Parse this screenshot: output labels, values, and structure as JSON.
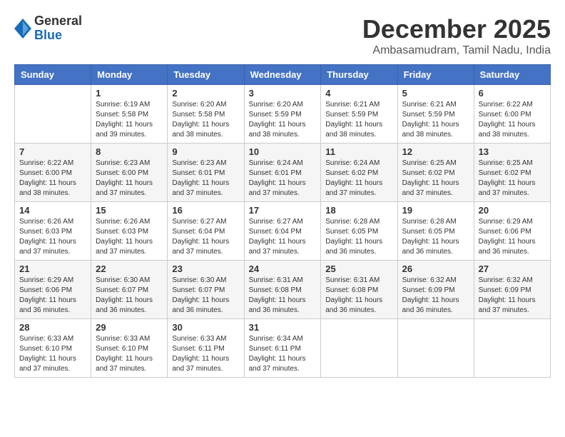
{
  "header": {
    "logo": {
      "general": "General",
      "blue": "Blue"
    },
    "title": "December 2025",
    "location": "Ambasamudram, Tamil Nadu, India"
  },
  "calendar": {
    "days_of_week": [
      "Sunday",
      "Monday",
      "Tuesday",
      "Wednesday",
      "Thursday",
      "Friday",
      "Saturday"
    ],
    "weeks": [
      [
        {
          "day": "",
          "info": ""
        },
        {
          "day": "1",
          "info": "Sunrise: 6:19 AM\nSunset: 5:58 PM\nDaylight: 11 hours\nand 39 minutes."
        },
        {
          "day": "2",
          "info": "Sunrise: 6:20 AM\nSunset: 5:58 PM\nDaylight: 11 hours\nand 38 minutes."
        },
        {
          "day": "3",
          "info": "Sunrise: 6:20 AM\nSunset: 5:59 PM\nDaylight: 11 hours\nand 38 minutes."
        },
        {
          "day": "4",
          "info": "Sunrise: 6:21 AM\nSunset: 5:59 PM\nDaylight: 11 hours\nand 38 minutes."
        },
        {
          "day": "5",
          "info": "Sunrise: 6:21 AM\nSunset: 5:59 PM\nDaylight: 11 hours\nand 38 minutes."
        },
        {
          "day": "6",
          "info": "Sunrise: 6:22 AM\nSunset: 6:00 PM\nDaylight: 11 hours\nand 38 minutes."
        }
      ],
      [
        {
          "day": "7",
          "info": "Sunrise: 6:22 AM\nSunset: 6:00 PM\nDaylight: 11 hours\nand 38 minutes."
        },
        {
          "day": "8",
          "info": "Sunrise: 6:23 AM\nSunset: 6:00 PM\nDaylight: 11 hours\nand 37 minutes."
        },
        {
          "day": "9",
          "info": "Sunrise: 6:23 AM\nSunset: 6:01 PM\nDaylight: 11 hours\nand 37 minutes."
        },
        {
          "day": "10",
          "info": "Sunrise: 6:24 AM\nSunset: 6:01 PM\nDaylight: 11 hours\nand 37 minutes."
        },
        {
          "day": "11",
          "info": "Sunrise: 6:24 AM\nSunset: 6:02 PM\nDaylight: 11 hours\nand 37 minutes."
        },
        {
          "day": "12",
          "info": "Sunrise: 6:25 AM\nSunset: 6:02 PM\nDaylight: 11 hours\nand 37 minutes."
        },
        {
          "day": "13",
          "info": "Sunrise: 6:25 AM\nSunset: 6:02 PM\nDaylight: 11 hours\nand 37 minutes."
        }
      ],
      [
        {
          "day": "14",
          "info": "Sunrise: 6:26 AM\nSunset: 6:03 PM\nDaylight: 11 hours\nand 37 minutes."
        },
        {
          "day": "15",
          "info": "Sunrise: 6:26 AM\nSunset: 6:03 PM\nDaylight: 11 hours\nand 37 minutes."
        },
        {
          "day": "16",
          "info": "Sunrise: 6:27 AM\nSunset: 6:04 PM\nDaylight: 11 hours\nand 37 minutes."
        },
        {
          "day": "17",
          "info": "Sunrise: 6:27 AM\nSunset: 6:04 PM\nDaylight: 11 hours\nand 37 minutes."
        },
        {
          "day": "18",
          "info": "Sunrise: 6:28 AM\nSunset: 6:05 PM\nDaylight: 11 hours\nand 36 minutes."
        },
        {
          "day": "19",
          "info": "Sunrise: 6:28 AM\nSunset: 6:05 PM\nDaylight: 11 hours\nand 36 minutes."
        },
        {
          "day": "20",
          "info": "Sunrise: 6:29 AM\nSunset: 6:06 PM\nDaylight: 11 hours\nand 36 minutes."
        }
      ],
      [
        {
          "day": "21",
          "info": "Sunrise: 6:29 AM\nSunset: 6:06 PM\nDaylight: 11 hours\nand 36 minutes."
        },
        {
          "day": "22",
          "info": "Sunrise: 6:30 AM\nSunset: 6:07 PM\nDaylight: 11 hours\nand 36 minutes."
        },
        {
          "day": "23",
          "info": "Sunrise: 6:30 AM\nSunset: 6:07 PM\nDaylight: 11 hours\nand 36 minutes."
        },
        {
          "day": "24",
          "info": "Sunrise: 6:31 AM\nSunset: 6:08 PM\nDaylight: 11 hours\nand 36 minutes."
        },
        {
          "day": "25",
          "info": "Sunrise: 6:31 AM\nSunset: 6:08 PM\nDaylight: 11 hours\nand 36 minutes."
        },
        {
          "day": "26",
          "info": "Sunrise: 6:32 AM\nSunset: 6:09 PM\nDaylight: 11 hours\nand 36 minutes."
        },
        {
          "day": "27",
          "info": "Sunrise: 6:32 AM\nSunset: 6:09 PM\nDaylight: 11 hours\nand 37 minutes."
        }
      ],
      [
        {
          "day": "28",
          "info": "Sunrise: 6:33 AM\nSunset: 6:10 PM\nDaylight: 11 hours\nand 37 minutes."
        },
        {
          "day": "29",
          "info": "Sunrise: 6:33 AM\nSunset: 6:10 PM\nDaylight: 11 hours\nand 37 minutes."
        },
        {
          "day": "30",
          "info": "Sunrise: 6:33 AM\nSunset: 6:11 PM\nDaylight: 11 hours\nand 37 minutes."
        },
        {
          "day": "31",
          "info": "Sunrise: 6:34 AM\nSunset: 6:11 PM\nDaylight: 11 hours\nand 37 minutes."
        },
        {
          "day": "",
          "info": ""
        },
        {
          "day": "",
          "info": ""
        },
        {
          "day": "",
          "info": ""
        }
      ]
    ]
  }
}
